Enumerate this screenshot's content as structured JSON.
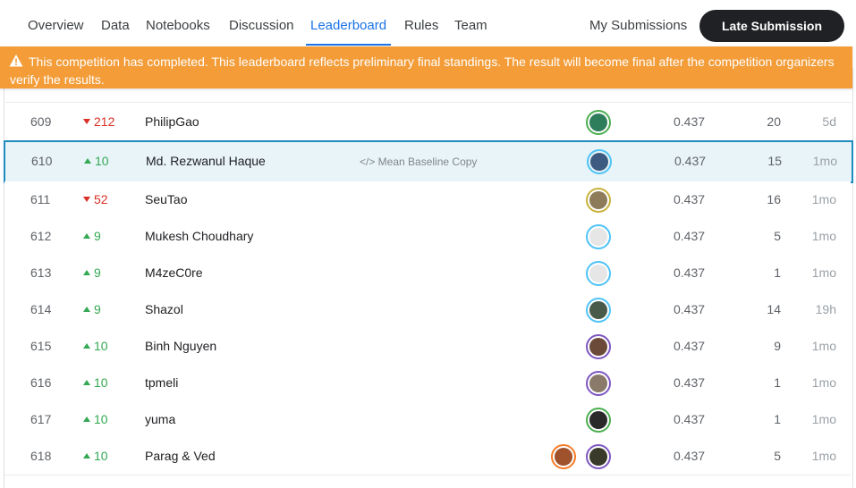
{
  "nav": {
    "tabs": [
      "Overview",
      "Data",
      "Notebooks",
      "Discussion",
      "Leaderboard",
      "Rules",
      "Team"
    ],
    "active_tab": "Leaderboard",
    "my_submissions": "My Submissions",
    "late_submission": "Late Submission"
  },
  "banner": {
    "text": "This competition has completed. This leaderboard reflects preliminary final standings. The result will become final after the competition organizers verify the results."
  },
  "rows": [
    {
      "rank": "609",
      "delta_dir": "down",
      "delta": "212",
      "name": "PhilipGao",
      "notebook": "",
      "score": "0.437",
      "entries": "20",
      "last": "5d",
      "avatar_style": "green",
      "avatar_color": "#2e7d5b"
    },
    {
      "rank": "610",
      "delta_dir": "up",
      "delta": "10",
      "name": "Md. Rezwanul Haque",
      "notebook": "</> Mean Baseline Copy",
      "score": "0.437",
      "entries": "15",
      "last": "1mo",
      "avatar_style": "blue",
      "avatar_color": "#3d5a80",
      "highlight": true
    },
    {
      "rank": "611",
      "delta_dir": "down",
      "delta": "52",
      "name": "SeuTao",
      "notebook": "",
      "score": "0.437",
      "entries": "16",
      "last": "1mo",
      "avatar_style": "gold",
      "avatar_color": "#8d7b5a"
    },
    {
      "rank": "612",
      "delta_dir": "up",
      "delta": "9",
      "name": "Mukesh Choudhary",
      "notebook": "",
      "score": "0.437",
      "entries": "5",
      "last": "1mo",
      "avatar_style": "blue",
      "avatar_color": "#e6e6e6"
    },
    {
      "rank": "613",
      "delta_dir": "up",
      "delta": "9",
      "name": "M4zeC0re",
      "notebook": "",
      "score": "0.437",
      "entries": "1",
      "last": "1mo",
      "avatar_style": "blue",
      "avatar_color": "#e6e6e6"
    },
    {
      "rank": "614",
      "delta_dir": "up",
      "delta": "9",
      "name": "Shazol",
      "notebook": "",
      "score": "0.437",
      "entries": "14",
      "last": "19h",
      "avatar_style": "blue",
      "avatar_color": "#4a5a4a"
    },
    {
      "rank": "615",
      "delta_dir": "up",
      "delta": "10",
      "name": "Binh Nguyen",
      "notebook": "",
      "score": "0.437",
      "entries": "9",
      "last": "1mo",
      "avatar_style": "purple",
      "avatar_color": "#6b4a3a"
    },
    {
      "rank": "616",
      "delta_dir": "up",
      "delta": "10",
      "name": "tpmeli",
      "notebook": "",
      "score": "0.437",
      "entries": "1",
      "last": "1mo",
      "avatar_style": "purple",
      "avatar_color": "#8a7a6a"
    },
    {
      "rank": "617",
      "delta_dir": "up",
      "delta": "10",
      "name": "yuma",
      "notebook": "",
      "score": "0.437",
      "entries": "1",
      "last": "1mo",
      "avatar_style": "green",
      "avatar_color": "#2a2a2a"
    },
    {
      "rank": "618",
      "delta_dir": "up",
      "delta": "10",
      "name": "Parag & Ved",
      "notebook": "",
      "score": "0.437",
      "entries": "5",
      "last": "1mo",
      "avatar_style": "purple",
      "avatar_color": "#3a3a2a",
      "team_avatar_color": "#a0522d"
    }
  ],
  "colors": {
    "accent": "#1a73e8",
    "banner": "#f39c38",
    "up": "#34a853",
    "down": "#d93025",
    "highlight_border": "#1f8bbf"
  }
}
